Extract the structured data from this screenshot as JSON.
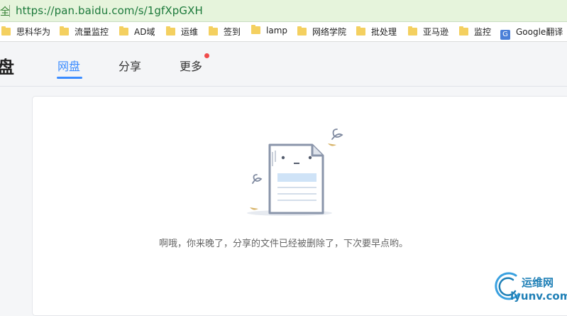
{
  "browser": {
    "address_prefix": "全",
    "url": "https://pan.baidu.com/s/1gfXpGXH"
  },
  "bookmarks": [
    {
      "label": "思科华为",
      "icon": "folder-icon"
    },
    {
      "label": "流量监控",
      "icon": "folder-icon"
    },
    {
      "label": "AD域",
      "icon": "folder-icon"
    },
    {
      "label": "运维",
      "icon": "folder-icon"
    },
    {
      "label": "签到",
      "icon": "folder-icon"
    },
    {
      "label": "lamp",
      "icon": "folder-icon"
    },
    {
      "label": "网络学院",
      "icon": "folder-icon"
    },
    {
      "label": "批处理",
      "icon": "folder-icon"
    },
    {
      "label": "亚马逊",
      "icon": "folder-icon"
    },
    {
      "label": "监控",
      "icon": "folder-icon"
    },
    {
      "label": "Google翻译",
      "icon": "google-translate-icon"
    }
  ],
  "header": {
    "logo_text": "盘",
    "tabs": [
      {
        "label": "网盘",
        "active": true
      },
      {
        "label": "分享",
        "active": false
      },
      {
        "label": "更多",
        "active": false,
        "badge": true
      }
    ]
  },
  "main": {
    "message": "啊哦，你来晚了，分享的文件已经被删除了，下次要早点哟。",
    "illustration": "sad-document-icon"
  },
  "watermark": {
    "line1": "运维网",
    "line2": "iyunv.com"
  },
  "colors": {
    "accent": "#3b8cff",
    "badge": "#f04b4b",
    "url_green": "#1d7a3c"
  }
}
